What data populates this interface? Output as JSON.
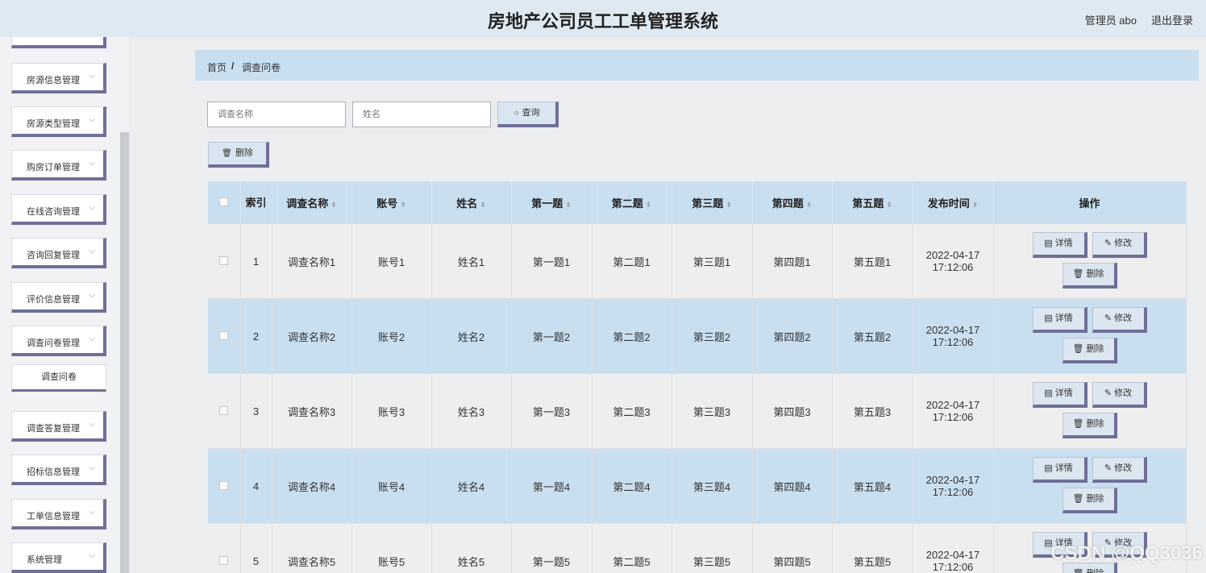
{
  "header": {
    "title": "房地产公司员工工单管理系统",
    "user": "管理员 abo",
    "logout": "退出登录"
  },
  "sidebar": {
    "items": [
      {
        "label": "房源信息管理"
      },
      {
        "label": "房源类型管理"
      },
      {
        "label": "购房订单管理"
      },
      {
        "label": "在线咨询管理"
      },
      {
        "label": "咨询回复管理"
      },
      {
        "label": "评价信息管理"
      },
      {
        "label": "调查问卷管理"
      },
      {
        "label": "调查答复管理"
      },
      {
        "label": "招标信息管理"
      },
      {
        "label": "工单信息管理"
      },
      {
        "label": "系统管理"
      }
    ],
    "sub_item": "调查问卷"
  },
  "breadcrumb": {
    "home": "首页",
    "sep": "/",
    "current": "调查问卷"
  },
  "search": {
    "name_placeholder": "调查名称",
    "person_placeholder": "姓名",
    "query_label": "查询",
    "delete_label": "删除"
  },
  "table": {
    "headers": [
      "索引",
      "调查名称",
      "账号",
      "姓名",
      "第一题",
      "第二题",
      "第三题",
      "第四题",
      "第五题",
      "发布时间",
      "操作"
    ],
    "rows": [
      {
        "index": "1",
        "name": "调查名称1",
        "account": "账号1",
        "person": "姓名1",
        "q1": "第一题1",
        "q2": "第二题1",
        "q3": "第三题1",
        "q4": "第四题1",
        "q5": "第五题1",
        "time": "2022-04-17 17:12:06"
      },
      {
        "index": "2",
        "name": "调查名称2",
        "account": "账号2",
        "person": "姓名2",
        "q1": "第一题2",
        "q2": "第二题2",
        "q3": "第三题2",
        "q4": "第四题2",
        "q5": "第五题2",
        "time": "2022-04-17 17:12:06"
      },
      {
        "index": "3",
        "name": "调查名称3",
        "account": "账号3",
        "person": "姓名3",
        "q1": "第一题3",
        "q2": "第二题3",
        "q3": "第三题3",
        "q4": "第四题3",
        "q5": "第五题3",
        "time": "2022-04-17 17:12:06"
      },
      {
        "index": "4",
        "name": "调查名称4",
        "account": "账号4",
        "person": "姓名4",
        "q1": "第一题4",
        "q2": "第二题4",
        "q3": "第三题4",
        "q4": "第四题4",
        "q5": "第五题4",
        "time": "2022-04-17 17:12:06"
      },
      {
        "index": "5",
        "name": "调查名称5",
        "account": "账号5",
        "person": "姓名5",
        "q1": "第一题5",
        "q2": "第二题5",
        "q3": "第三题5",
        "q4": "第四题5",
        "q5": "第五题5",
        "time": "2022-04-17 17:12:06"
      }
    ],
    "ops": {
      "detail": "详情",
      "edit": "修改",
      "delete": "删除"
    }
  },
  "watermark": "CSDN @QQ3036",
  "icons": {
    "search": "search-icon",
    "delete": "trash-icon",
    "detail": "document-icon",
    "edit": "pencil-icon",
    "chevron": "chevron-down-icon"
  }
}
